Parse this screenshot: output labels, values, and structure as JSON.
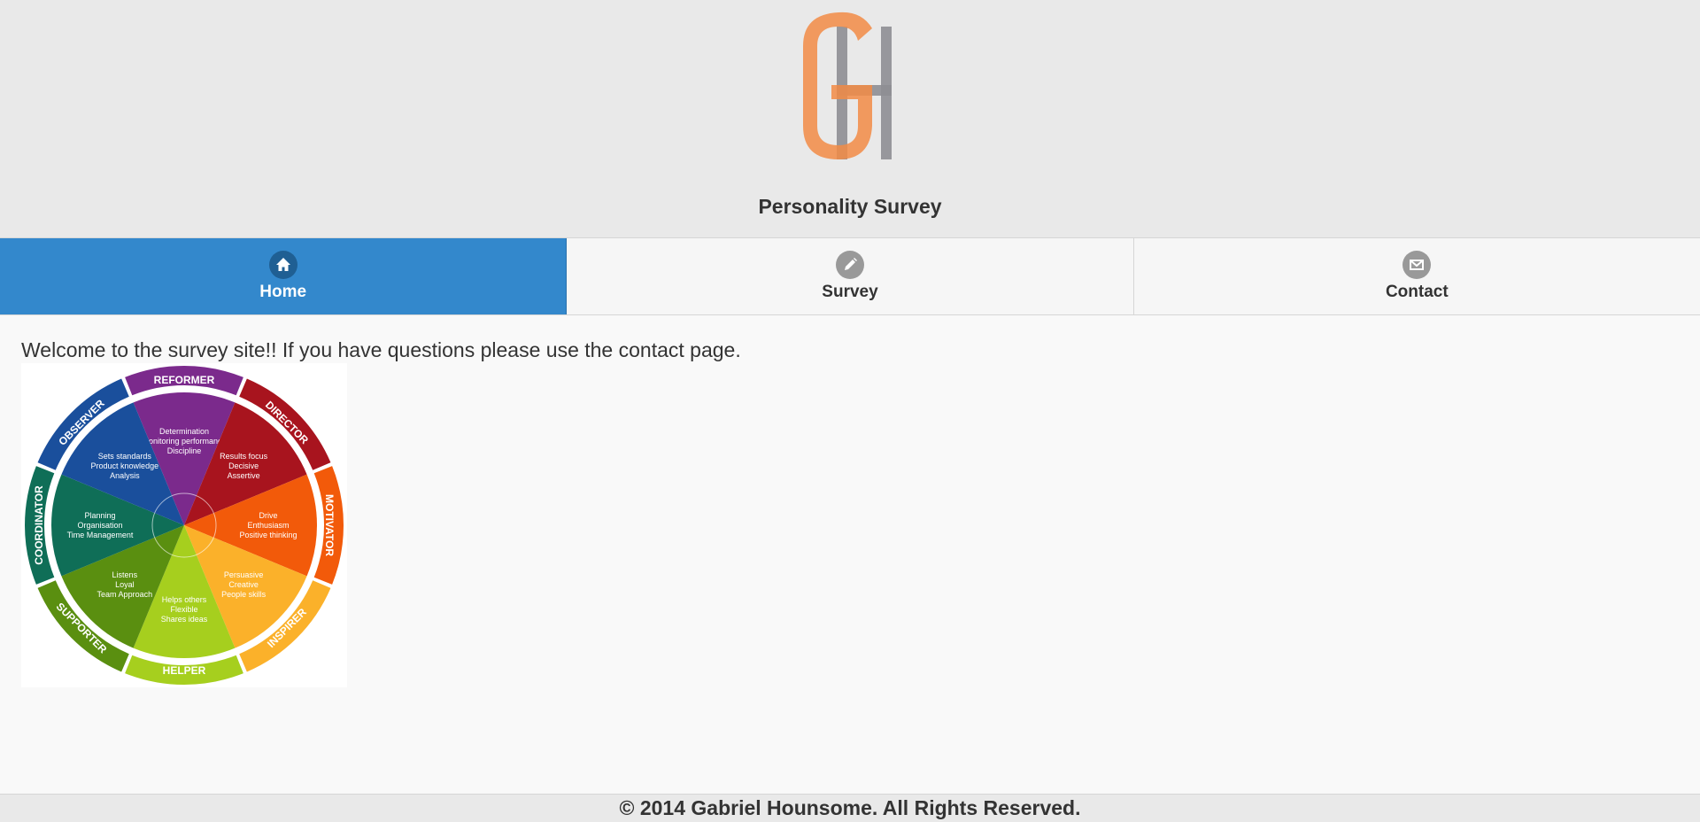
{
  "header": {
    "logo_letters": "GH",
    "title": "Personality Survey"
  },
  "nav": {
    "items": [
      {
        "label": "Home",
        "icon": "home-icon",
        "active": true
      },
      {
        "label": "Survey",
        "icon": "pencil-icon",
        "active": false
      },
      {
        "label": "Contact",
        "icon": "mail-icon",
        "active": false
      }
    ]
  },
  "main": {
    "welcome_text": "Welcome to the survey site!! If you have questions please use the contact page."
  },
  "wheel": {
    "segments": [
      {
        "name": "REFORMER",
        "lines": [
          "Determination",
          "Monitoring performance",
          "Discipline"
        ],
        "color": "#7b2a8c",
        "ring": "#7b2a8c"
      },
      {
        "name": "DIRECTOR",
        "lines": [
          "Results focus",
          "Decisive",
          "Assertive"
        ],
        "color": "#a8141e",
        "ring": "#a8141e"
      },
      {
        "name": "MOTIVATOR",
        "lines": [
          "Drive",
          "Enthusiasm",
          "Positive thinking"
        ],
        "color": "#f25a0a",
        "ring": "#f25a0a"
      },
      {
        "name": "INSPIRER",
        "lines": [
          "Persuasive",
          "Creative",
          "People skills"
        ],
        "color": "#fbb12a",
        "ring": "#fbb12a"
      },
      {
        "name": "HELPER",
        "lines": [
          "Helps others",
          "Flexible",
          "Shares ideas"
        ],
        "color": "#a6cf1e",
        "ring": "#a6cf1e"
      },
      {
        "name": "SUPPORTER",
        "lines": [
          "Listens",
          "Loyal",
          "Team Approach"
        ],
        "color": "#5a8f10",
        "ring": "#5a8f10"
      },
      {
        "name": "COORDINATOR",
        "lines": [
          "Planning",
          "Organisation",
          "Time Management"
        ],
        "color": "#0f6e57",
        "ring": "#0f6e57"
      },
      {
        "name": "OBSERVER",
        "lines": [
          "Sets standards",
          "Product knowledge",
          "Analysis"
        ],
        "color": "#1a4f9c",
        "ring": "#1a4f9c"
      }
    ]
  },
  "footer": {
    "copyright": "© 2014 Gabriel Hounsome. All Rights Reserved."
  }
}
